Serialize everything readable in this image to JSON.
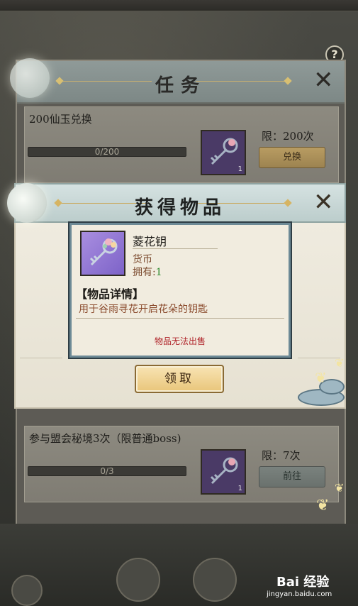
{
  "task_window": {
    "title": "任务",
    "help": "?",
    "close": "✕",
    "tasks": [
      {
        "name": "200仙玉兑换",
        "progress": "0/200",
        "progress_fraction": 0,
        "limit": "限：200次",
        "button": "兑换",
        "count": "1"
      },
      {
        "name": "参与盟会秘境3次（限普通boss)",
        "progress": "0/3",
        "progress_fraction": 0,
        "limit": "限：7次",
        "button": "前往",
        "count": "1"
      }
    ]
  },
  "dialog": {
    "title": "获得物品",
    "close": "✕",
    "item": {
      "name": "菱花钥",
      "type": "货币",
      "own_label": "拥有:",
      "own_count": "1"
    },
    "details_title": "【物品详情】",
    "description": "用于谷雨寻花开启花朵的钥匙",
    "unsellable": "物品无法出售",
    "claim_button": "领取"
  },
  "watermark": {
    "brand": "Bai 经验",
    "url": "jingyan.baidu.com"
  },
  "colors": {
    "accent_gold": "#e9c57a",
    "warning_red": "#b0242a",
    "own_green": "#2e8a2e"
  },
  "icons": [
    "help-icon",
    "close-icon",
    "key-icon",
    "butterfly-icon",
    "moon-icon"
  ]
}
